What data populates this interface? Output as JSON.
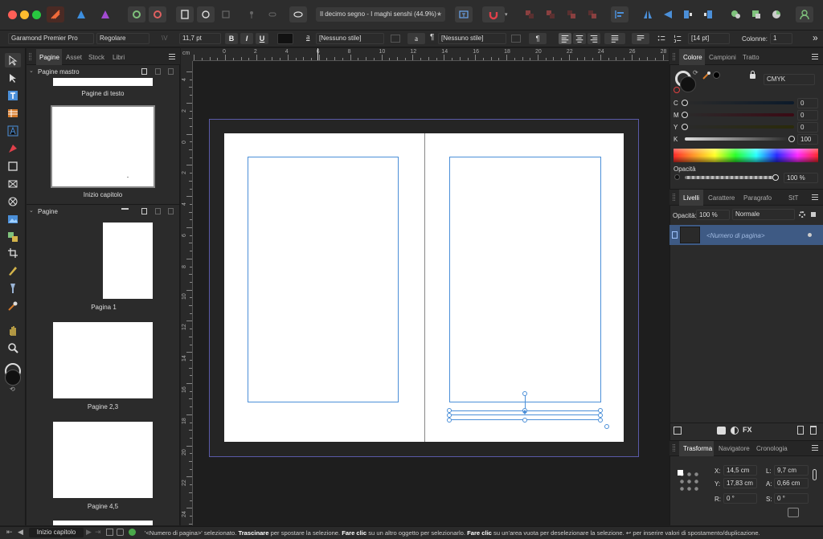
{
  "toolbar": {
    "document_title": "Il decimo segno - I maghi senshi (44.9%)",
    "star": "★"
  },
  "context": {
    "font_family": "Garamond Premier Pro",
    "font_style": "Regolare",
    "font_size": "11,7 pt",
    "bold": "B",
    "italic": "I",
    "underline": "U",
    "char_style_glyph": "a",
    "char_style": "[Nessuno stile]",
    "char_glyph2": "a",
    "para_glyph": "¶",
    "para_style": "[Nessuno stile]",
    "para_glyph2": "¶",
    "leading": "[14 pt]",
    "columns_label": "Colonne:",
    "columns_value": "1",
    "more": "»"
  },
  "left_panel": {
    "tabs": [
      "Pagine",
      "Asset",
      "Stock",
      "Libri"
    ],
    "master_header": "Pagine mastro",
    "master_pages": [
      "Pagine di testo",
      "Inizio capitolo"
    ],
    "pages_header": "Pagine",
    "pages": [
      "Pagina 1",
      "Pagine 2,3",
      "Pagine 4,5"
    ]
  },
  "ruler": {
    "unit": "cm",
    "h_labels": [
      "0",
      "2",
      "4",
      "6",
      "8",
      "10",
      "12",
      "14",
      "16",
      "18",
      "20",
      "22",
      "24",
      "26",
      "28"
    ],
    "v_labels": [
      "4",
      "2",
      "0",
      "2",
      "4",
      "6",
      "8",
      "10",
      "12",
      "14",
      "16",
      "18",
      "20",
      "22",
      "24"
    ]
  },
  "color_panel": {
    "tabs": [
      "Colore",
      "Campioni",
      "Tratto"
    ],
    "model": "CMYK",
    "channels": [
      {
        "label": "C",
        "value": "0",
        "level": 0
      },
      {
        "label": "M",
        "value": "0",
        "level": 0
      },
      {
        "label": "Y",
        "value": "0",
        "level": 0
      },
      {
        "label": "K",
        "value": "100",
        "level": 1
      }
    ],
    "opacity_label": "Opacità",
    "opacity_value": "100 %"
  },
  "layers_panel": {
    "tabs": [
      "Livelli",
      "Carattere",
      "Paragrafo",
      "StT"
    ],
    "opacity_label": "Opacità:",
    "opacity_value": "100 %",
    "blend_mode": "Normale",
    "layer_name": "<Numero di pagina>"
  },
  "transform_panel": {
    "tabs": [
      "Trasforma",
      "Navigatore",
      "Cronologia"
    ],
    "x_label": "X:",
    "x_value": "14,5 cm",
    "y_label": "Y:",
    "y_value": "17,83 cm",
    "l_label": "L:",
    "l_value": "9,7 cm",
    "a_label": "A:",
    "a_value": "0,66 cm",
    "r_label": "R:",
    "r_value": "0 °",
    "s_label": "S:",
    "s_value": "0 °"
  },
  "status_bar": {
    "current_page": "Inizio capitolo",
    "msg_1": "'<Numero di pagina>' selezionato.",
    "msg_2": "Trascinare",
    "msg_3": "per spostare la selezione.",
    "msg_4": "Fare clic",
    "msg_5": "su un altro oggetto per selezionarlo.",
    "msg_6": "Fare clic",
    "msg_7": "su un'area vuota per deselezionare la selezione.",
    "msg_8": "↩ per inserire valori di spostamento/duplicazione."
  },
  "colors": {
    "selection": "#4b8fd8",
    "layer_row": "#3e5a84",
    "close": "#ff5f57",
    "minimize": "#febc2e",
    "zoom": "#28c840"
  }
}
